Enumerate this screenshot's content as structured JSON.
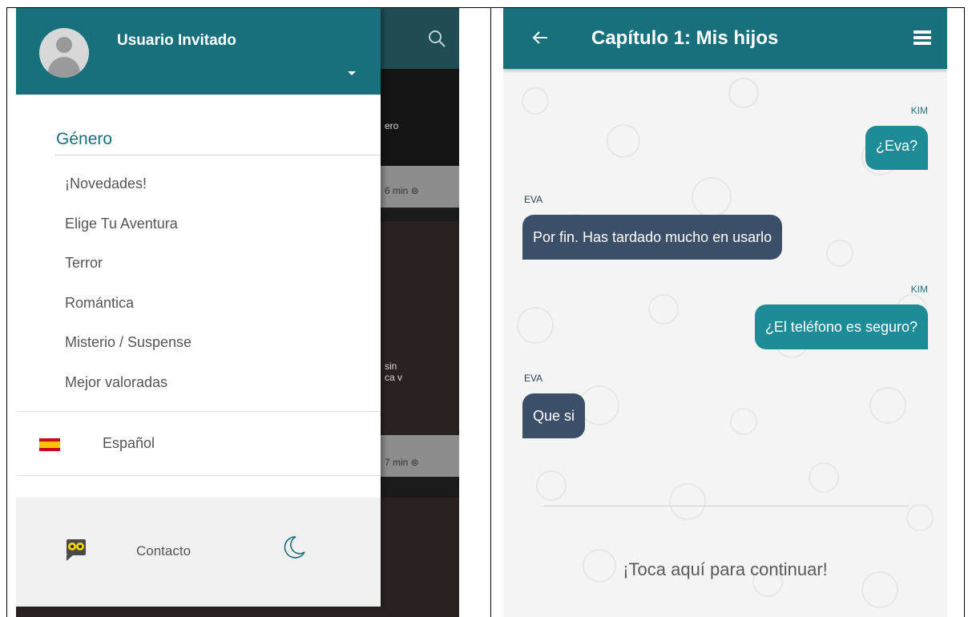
{
  "left_screen": {
    "drawer": {
      "user_name": "Usuario Invitado",
      "section_title": "Género",
      "genres": [
        {
          "label": "¡Novedades!"
        },
        {
          "label": "Elige Tu Aventura"
        },
        {
          "label": "Terror"
        },
        {
          "label": "Romántica"
        },
        {
          "label": "Misterio / Suspense"
        },
        {
          "label": "Mejor valoradas"
        }
      ],
      "language": "Español",
      "contact": "Contacto",
      "icons": {
        "avatar": "user-avatar-icon",
        "flag": "spain-flag-icon",
        "owl": "owl-icon",
        "night": "moon-icon",
        "expand": "caret-down-icon"
      }
    },
    "background": {
      "partial_text_1": "ero",
      "duration_1": "6 min ⊚",
      "partial_text_2": "sin\nca v",
      "duration_2": "7 min ⊚",
      "search_icon": "search-icon"
    }
  },
  "right_screen": {
    "title": "Capítulo 1: Mis hijos",
    "back_icon": "arrow-left-icon",
    "menu_icon": "list-icon",
    "messages": [
      {
        "sender": "KIM",
        "text": "¿Eva?",
        "side": "right"
      },
      {
        "sender": "EVA",
        "text": "Por fin. Has tardado mucho en usarlo",
        "side": "left"
      },
      {
        "sender": "KIM",
        "text": "¿El teléfono es seguro?",
        "side": "right"
      },
      {
        "sender": "EVA",
        "text": "Que si",
        "side": "left"
      }
    ],
    "continue_prompt": "¡Toca aquí para continuar!"
  },
  "colors": {
    "primary": "#17707c",
    "bubble_out": "#1e8c96",
    "bubble_in": "#3b4f68"
  }
}
